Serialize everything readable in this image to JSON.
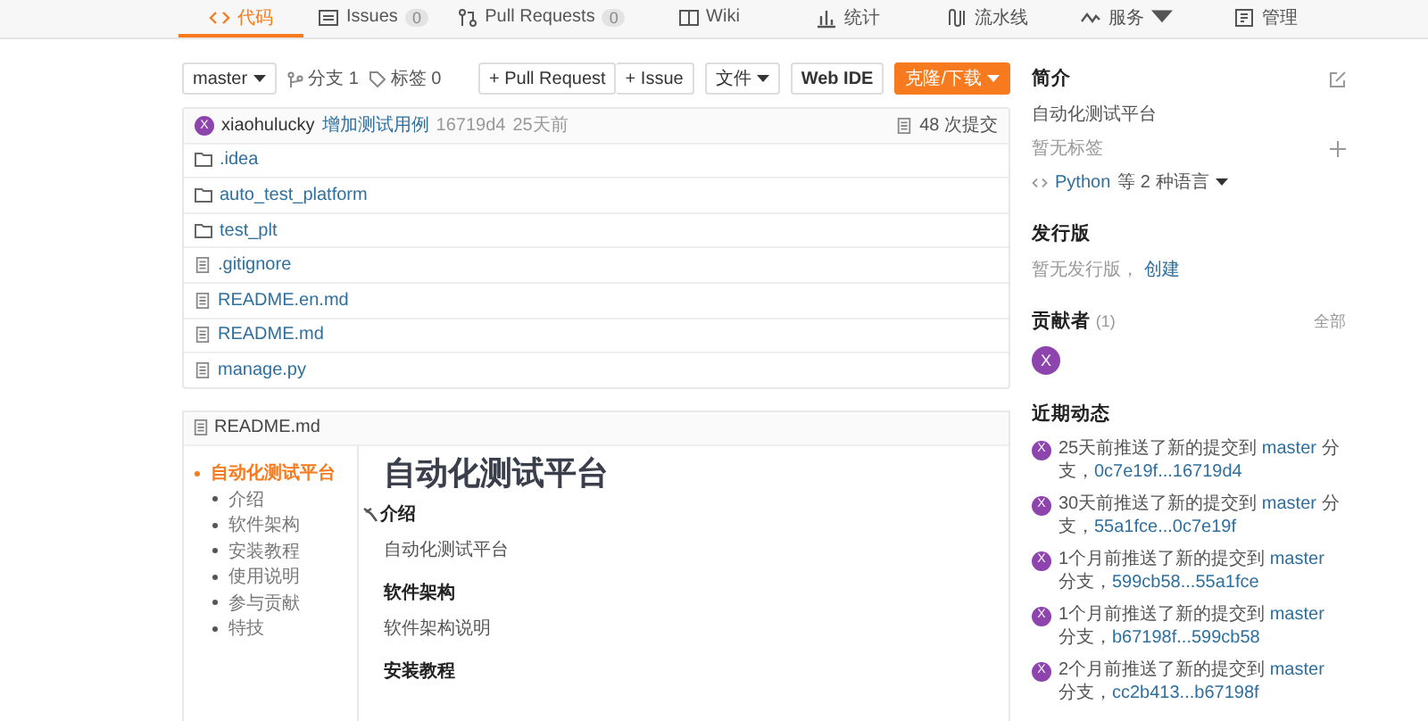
{
  "nav": {
    "tabs": [
      {
        "label": "代码",
        "selected": true
      },
      {
        "label": "Issues",
        "count": "0",
        "selected": false
      },
      {
        "label": "Pull Requests",
        "count": "0",
        "selected": false
      },
      {
        "label": "Wiki",
        "selected": false
      },
      {
        "label": "统计",
        "selected": false
      },
      {
        "label": "流水线",
        "selected": false
      },
      {
        "label": "服务",
        "dropdown": true,
        "selected": false
      },
      {
        "label": "管理",
        "selected": false
      }
    ]
  },
  "toolbar": {
    "branch": "master",
    "branches": "分支 1",
    "tags": "标签 0",
    "pull_request": "+ Pull Request",
    "issue": "+ Issue",
    "file_menu": "文件",
    "web_ide": "Web IDE",
    "clone": "克隆/下载"
  },
  "last_commit": {
    "avatar": "X",
    "author": "xiaohulucky",
    "message": "增加测试用例",
    "hash": "16719d4",
    "time": "25天前",
    "commits": "48 次提交"
  },
  "files": [
    {
      "name": ".idea",
      "kind": "folder"
    },
    {
      "name": "auto_test_platform",
      "kind": "folder"
    },
    {
      "name": "test_plt",
      "kind": "folder"
    },
    {
      "name": ".gitignore",
      "kind": "file"
    },
    {
      "name": "README.en.md",
      "kind": "file"
    },
    {
      "name": "README.md",
      "kind": "file"
    },
    {
      "name": "manage.py",
      "kind": "file"
    }
  ],
  "readme": {
    "filename": "README.md",
    "toc": [
      {
        "label": "自动化测试平台",
        "selected": true,
        "children": [
          {
            "label": "介绍",
            "selected": false
          },
          {
            "label": "软件架构",
            "selected": false
          },
          {
            "label": "安装教程",
            "selected": false
          },
          {
            "label": "使用说明",
            "selected": false
          },
          {
            "label": "参与贡献",
            "selected": false
          },
          {
            "label": "特技",
            "selected": false
          }
        ]
      }
    ],
    "title": "自动化测试平台",
    "sections": [
      {
        "heading": "介绍",
        "anchor": true,
        "body": "自动化测试平台"
      },
      {
        "heading": "软件架构",
        "anchor": false,
        "body": "软件架构说明"
      },
      {
        "heading": "安装教程",
        "anchor": false
      }
    ]
  },
  "sidebar": {
    "intro_title": "简介",
    "description": "自动化测试平台",
    "no_tags": "暂无标签",
    "language": "Python",
    "language_more": "等 2 种语言",
    "releases_title": "发行版",
    "no_releases": "暂无发行版，",
    "create": "创建",
    "contributors_title": "贡献者",
    "contributors_count": "(1)",
    "all": "全部",
    "contributors": [
      "X"
    ],
    "activity_title": "近期动态",
    "activity": [
      {
        "avatar": "X",
        "text": "25天前推送了新的提交到",
        "branch": "master",
        "suffix": "分支，",
        "range": "0c7e19f...16719d4"
      },
      {
        "avatar": "X",
        "text": "30天前推送了新的提交到",
        "branch": "master",
        "suffix": "分支，",
        "range": "55a1fce...0c7e19f"
      },
      {
        "avatar": "X",
        "text": "1个月前推送了新的提交到",
        "branch": "master",
        "suffix": "分支，",
        "range": "599cb58...55a1fce"
      },
      {
        "avatar": "X",
        "text": "1个月前推送了新的提交到",
        "branch": "master",
        "suffix": "分支，",
        "range": "b67198f...599cb58"
      },
      {
        "avatar": "X",
        "text": "2个月前推送了新的提交到",
        "branch": "master",
        "suffix": "分支，",
        "range": "cc2b413...b67198f"
      }
    ]
  }
}
